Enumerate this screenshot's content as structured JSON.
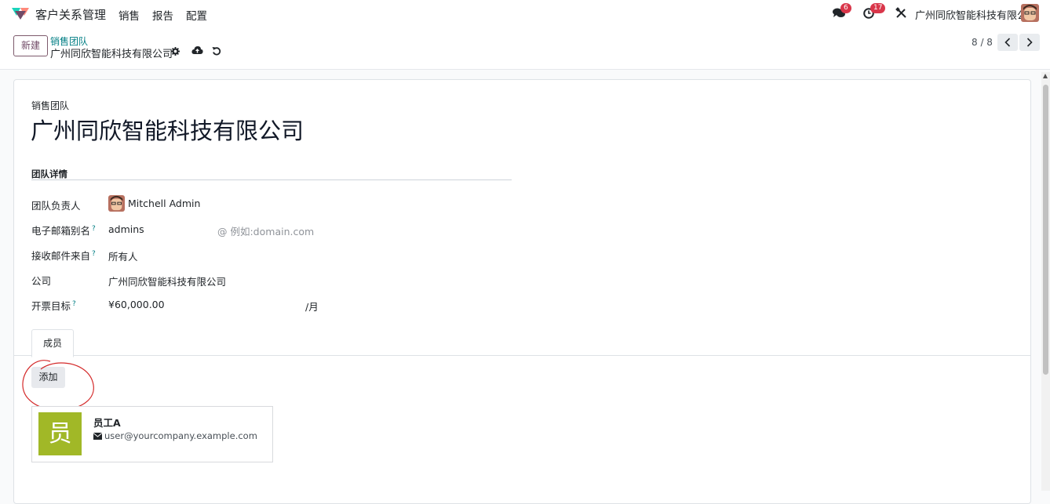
{
  "navbar": {
    "app_name": "客户关系管理",
    "menu": [
      "销售",
      "报告",
      "配置"
    ],
    "messages_count": "6",
    "activities_count": "17",
    "company": "广州同欣智能科技有限公司"
  },
  "control": {
    "new_label": "新建",
    "breadcrumb_parent": "销售团队",
    "breadcrumb_current": "广州同欣智能科技有限公司",
    "pager": "8 / 8"
  },
  "form": {
    "record_label": "销售团队",
    "title": "广州同欣智能科技有限公司",
    "group_title": "团队详情",
    "fields": {
      "leader_label": "团队负责人",
      "leader_value": "Mitchell Admin",
      "alias_label": "电子邮箱别名",
      "alias_value": "admins",
      "alias_domain": "@ 例如:domain.com",
      "accept_label": "接收邮件来自",
      "accept_value": "所有人",
      "company_label": "公司",
      "company_value": "广州同欣智能科技有限公司",
      "target_label": "开票目标",
      "target_value": "¥60,000.00",
      "target_unit": "/月",
      "help_mark": "?"
    },
    "tab_members": "成员",
    "add_label": "添加",
    "member": {
      "initial": "员",
      "name": "员工A",
      "email": "user@yourcompany.example.com"
    }
  },
  "colors": {
    "brand": "#714b67",
    "link": "#017e84",
    "badge": "#d9364a",
    "member_avatar": "#a1b827",
    "annotation": "#d42a2a"
  }
}
